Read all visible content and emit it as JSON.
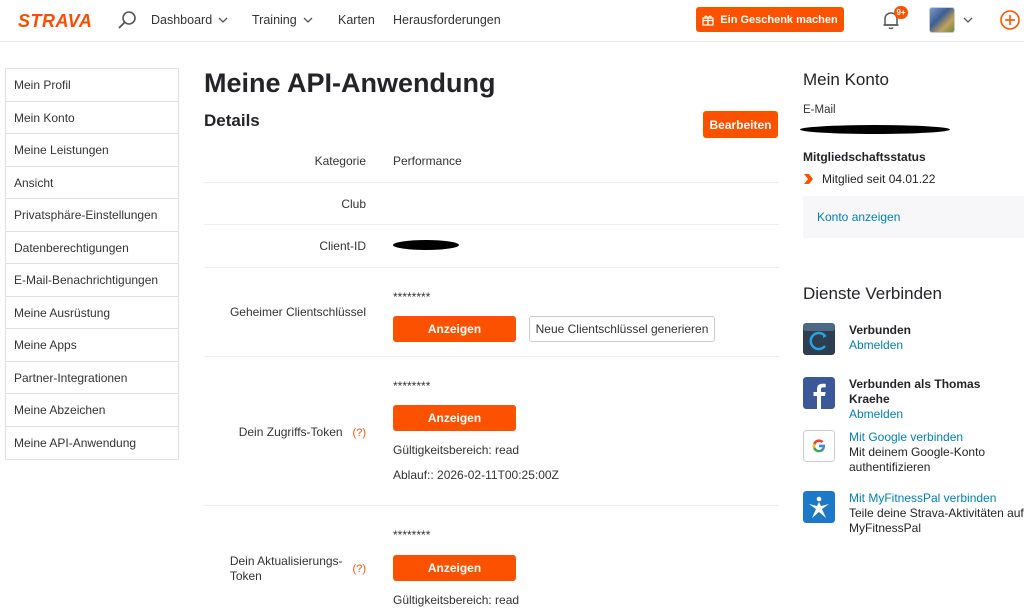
{
  "nav": {
    "logo": "STRAVA",
    "items": [
      "Dashboard",
      "Training",
      "Karten",
      "Herausforderungen"
    ],
    "gift_label": "Ein Geschenk machen",
    "badge": "9+"
  },
  "sidebar": {
    "items": [
      "Mein Profil",
      "Mein Konto",
      "Meine Leistungen",
      "Ansicht",
      "Privatsphäre-Einstellungen",
      "Datenberechtigungen",
      "E-Mail-Benachrichtigungen",
      "Meine Ausrüstung",
      "Meine Apps",
      "Partner-Integrationen",
      "Meine Abzeichen",
      "Meine API-Anwendung"
    ]
  },
  "main": {
    "title": "Meine API-Anwendung",
    "details": "Details",
    "edit_label": "Bearbeiten",
    "category_label": "Kategorie",
    "category_value": "Performance",
    "club_label": "Club",
    "client_id_label": "Client-ID",
    "secret_label": "Geheimer Clientschlüssel",
    "secret_masked": "********",
    "show_label": "Anzeigen",
    "regen_label": "Neue Clientschlüssel generieren",
    "access_label": "Dein Zugriffs-Token",
    "help": "(?)",
    "access_masked": "********",
    "access_scope": "Gültigkeitsbereich: read",
    "access_expiry": "Ablauf:: 2026-02-11T00:25:00Z",
    "refresh_label_1": "Dein Aktualisierungs-",
    "refresh_label_2": "Token",
    "refresh_masked": "********",
    "refresh_scope": "Gültigkeitsbereich: read"
  },
  "account": {
    "title": "Mein Konto",
    "email_label": "E-Mail",
    "status_label": "Mitgliedschaftsstatus",
    "member_since": "Mitglied seit 04.01.22",
    "view_account": "Konto anzeigen"
  },
  "services": {
    "title": "Dienste Verbinden",
    "items": [
      {
        "strong": "Verbunden",
        "link": "Abmelden",
        "desc": "",
        "icon": "garmin-connect-icon"
      },
      {
        "strong": "Verbunden als Thomas Kraehe",
        "link": "Abmelden",
        "desc": "",
        "icon": "facebook-icon"
      },
      {
        "strong": "",
        "link": "Mit Google verbinden",
        "desc": "Mit deinem Google-Konto authentifizieren",
        "icon": "google-icon"
      },
      {
        "strong": "",
        "link": "Mit MyFitnessPal verbinden",
        "desc": "Teile deine Strava-Aktivitäten auf MyFitnessPal",
        "icon": "myfitnesspal-icon"
      }
    ]
  },
  "colors": {
    "accent": "#fc5200",
    "link": "#007fb6"
  }
}
